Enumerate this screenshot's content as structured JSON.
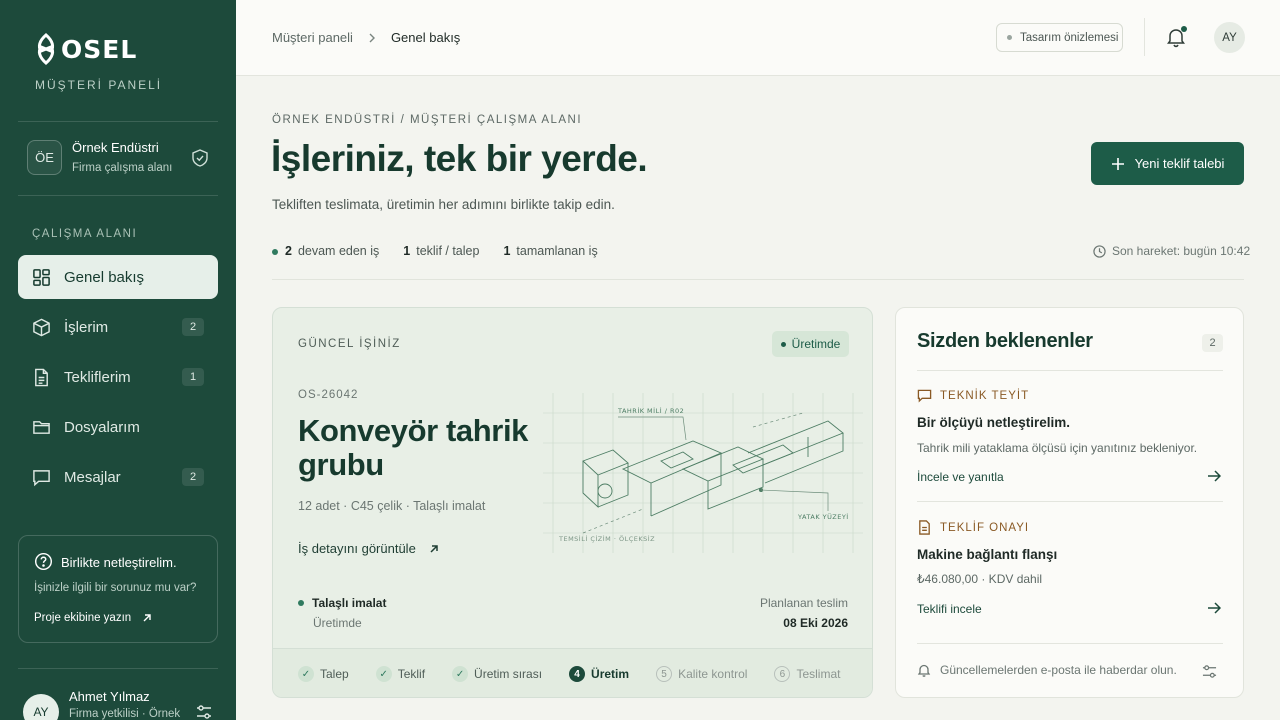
{
  "brand": {
    "logo_text": "OSEL",
    "subtitle": "MÜŞTERİ PANELİ"
  },
  "company": {
    "initials": "ÖE",
    "name": "Örnek Endüstri",
    "workspace": "Firma çalışma alanı"
  },
  "sidebar": {
    "section_label": "ÇALIŞMA ALANI",
    "items": [
      {
        "label": "Genel bakış",
        "icon": "grid-icon",
        "active": true
      },
      {
        "label": "İşlerim",
        "icon": "box-icon",
        "count": "2"
      },
      {
        "label": "Tekliflerim",
        "icon": "document-icon",
        "count": "1"
      },
      {
        "label": "Dosyalarım",
        "icon": "folder-icon"
      },
      {
        "label": "Mesajlar",
        "icon": "message-icon",
        "count": "2"
      }
    ],
    "help": {
      "title": "Birlikte netleştirelim.",
      "desc": "İşinizle ilgili bir sorunuz mu var?",
      "link": "Proje ekibine yazın"
    },
    "user": {
      "initials": "AY",
      "name": "Ahmet Yılmaz",
      "role": "Firma yetkilisi · Örnek"
    }
  },
  "topbar": {
    "breadcrumb": [
      "Müşteri paneli",
      "Genel bakış"
    ],
    "preview_label": "Tasarım önizlemesi",
    "avatar": "AY"
  },
  "header": {
    "kicker": "ÖRNEK ENDÜSTRİ / MÜŞTERİ ÇALIŞMA ALANI",
    "title": "İşleriniz, tek bir yerde.",
    "lead": "Tekliften teslimata, üretimin her adımını birlikte takip edin.",
    "new_button": "Yeni teklif talebi",
    "stats": [
      {
        "value": "2",
        "label": "devam eden iş"
      },
      {
        "value": "1",
        "label": "teklif / talep"
      },
      {
        "value": "1",
        "label": "tamamlanan iş"
      }
    ],
    "last_activity": "Son hareket: bugün 10:42"
  },
  "job": {
    "section_label": "GÜNCEL İŞİNİZ",
    "status": "Üretimde",
    "code": "OS-26042",
    "title": "Konveyör tahrik grubu",
    "spec": "12 adet · C45 çelik · Talaşlı imalat",
    "detail_link": "İş detayını görüntüle",
    "drawing_labels": {
      "top": "TAHRİK MİLİ / R02",
      "right": "YATAK YÜZEYİ",
      "bottom": "TEMSİLİ ÇİZİM · ÖLÇEKSİZ"
    },
    "phase": "Talaşlı imalat",
    "phase_status": "Üretimde",
    "planned_label": "Planlanan teslim",
    "planned_date": "08 Eki 2026",
    "steps": [
      {
        "label": "Talep",
        "state": "done",
        "mark": "✓"
      },
      {
        "label": "Teklif",
        "state": "done",
        "mark": "✓"
      },
      {
        "label": "Üretim sırası",
        "state": "done",
        "mark": "✓"
      },
      {
        "label": "Üretim",
        "state": "current",
        "mark": "4"
      },
      {
        "label": "Kalite kontrol",
        "state": "todo",
        "mark": "5"
      },
      {
        "label": "Teslimat",
        "state": "todo",
        "mark": "6"
      }
    ]
  },
  "pending": {
    "title": "Sizden beklenenler",
    "count": "2",
    "tasks": [
      {
        "tag": "TEKNİK TEYİT",
        "title": "Bir ölçüyü netleştirelim.",
        "desc": "Tahrik mili yataklama ölçüsü için yanıtınız bekleniyor.",
        "link": "İncele ve yanıtla"
      },
      {
        "tag": "TEKLİF ONAYI",
        "title": "Makine bağlantı flanşı",
        "desc": "₺46.080,00 · KDV dahil",
        "link": "Teklifi incele"
      }
    ],
    "notify": "Güncellemelerden e-posta ile haberdar olun."
  },
  "colors": {
    "sidebar": "#1d4a3b",
    "accent": "#1d5c48",
    "task_tag": "#8a5a25"
  }
}
